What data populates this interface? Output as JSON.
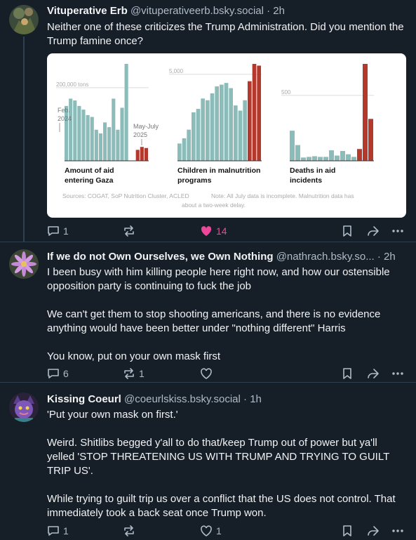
{
  "posts": [
    {
      "name": "Vituperative Erb",
      "handle": "@vituperativeerb.bsky.social",
      "time": "· 2h",
      "paragraphs": [
        "Neither one of these criticizes the Trump Administration. Did you mention the Trump famine once?"
      ],
      "replies": "1",
      "reposts": "",
      "likes": "14",
      "liked": true
    },
    {
      "name": "If we do not Own Ourselves, we Own Nothing",
      "handle": "@nathrach.bsky.so...",
      "time": "· 2h",
      "paragraphs": [
        "I been busy with him killing people here right now, and how our ostensible opposition party is continuing to fuck the job",
        "We can't get them to stop shooting americans, and there is no evidence anything would have been better under \"nothing different\" Harris",
        "You know, put on your own mask first"
      ],
      "replies": "6",
      "reposts": "1",
      "likes": "",
      "liked": false
    },
    {
      "name": "Kissing Coeurl",
      "handle": "@coeurlskiss.bsky.social",
      "time": "· 1h",
      "paragraphs": [
        "'Put your own mask on first.'",
        "Weird. Shitlibs begged y'all to do that/keep Trump out of power but ya'll yelled 'STOP THREATENING US WITH TRUMP AND TRYING TO GUILT TRIP US'.",
        "While trying to guilt trip us over a conflict that the US does not control. That immediately took a back seat once Trump won."
      ],
      "replies": "1",
      "reposts": "",
      "likes": "1",
      "liked": false
    }
  ],
  "colors": {
    "background": "#161e27",
    "teal_bar": "#8bbcb9",
    "red_bar": "#b4392d",
    "like_pink": "#ec4899",
    "muted": "#aebbc9"
  },
  "icons": [
    "reply-icon",
    "repost-icon",
    "heart-icon",
    "bookmark-icon",
    "share-icon",
    "more-icon"
  ],
  "chart_data": [
    {
      "type": "bar",
      "title": "Amount of aid entering Gaza",
      "ytick": "200,000 tons",
      "annotations": [
        "Feb. 2024",
        "May-July 2025"
      ],
      "values": [
        150000,
        170000,
        165000,
        150000,
        140000,
        125000,
        120000,
        85000,
        75000,
        105000,
        92000,
        170000,
        85000,
        145000,
        265000,
        30000,
        38000,
        35000
      ],
      "highlight_last": 3
    },
    {
      "type": "bar",
      "title": "Children in malnutrition programs",
      "ytick": "5,000",
      "values": [
        1000,
        1300,
        1800,
        2800,
        3000,
        3600,
        3500,
        3900,
        4300,
        4400,
        4500,
        4200,
        3200,
        2900,
        3500,
        4600,
        5600,
        5500
      ],
      "highlight_last": 3
    },
    {
      "type": "bar",
      "title": "Deaths in aid incidents",
      "ytick": "500",
      "values": [
        230,
        120,
        25,
        30,
        35,
        30,
        30,
        80,
        40,
        75,
        50,
        30,
        90,
        740,
        320
      ],
      "highlight_last": 3
    }
  ],
  "chart_caption": {
    "sources": "Sources: COGAT, SoP Nutrition Cluster, ACLED",
    "note_line1": "Note: All July data is incomplete. Malnutrition data has",
    "note_line2": "about a two-week delay."
  }
}
